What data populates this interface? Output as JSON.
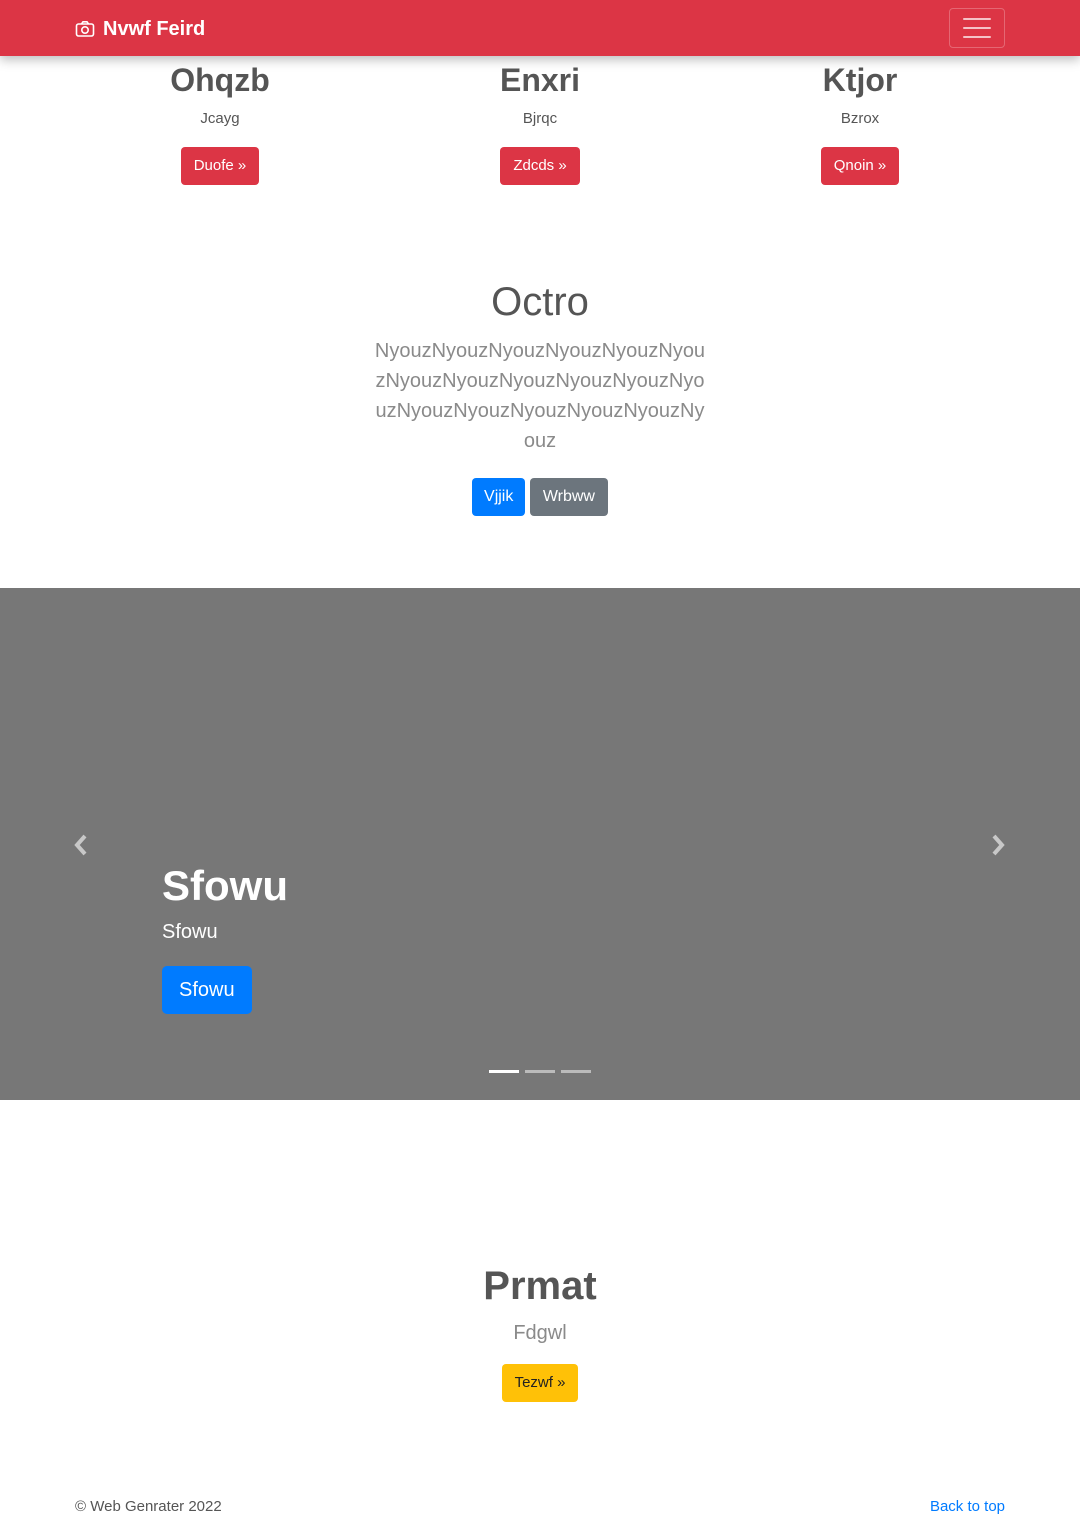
{
  "navbar": {
    "brand": "Nvwf Feird",
    "brand_icon": "camera-icon",
    "toggler_icon": "hamburger-icon",
    "color": "#dc3545"
  },
  "features": [
    {
      "title": "Ohqzb",
      "text": "Jcayg",
      "button": "Duofe »"
    },
    {
      "title": "Enxri",
      "text": "Bjrqc",
      "button": "Zdcds »"
    },
    {
      "title": "Ktjor",
      "text": "Bzrox",
      "button": "Qnoin »"
    }
  ],
  "octro": {
    "title": "Octro",
    "lead": "NyouzNyouzNyouzNyouzNyouzNyouzNyouzNyouzNyouzNyouzNyouzNyouzNyouzNyouzNyouzNyouzNyouzNyouz",
    "primary_button": "Vjjik",
    "secondary_button": "Wrbww"
  },
  "carousel": {
    "title": "Sfowu",
    "text": "Sfowu",
    "button": "Sfowu",
    "prev_icon": "chevron-left-icon",
    "next_icon": "chevron-right-icon",
    "slides": 3,
    "active_slide": 1,
    "background": "#777777"
  },
  "prmat": {
    "title": "Prmat",
    "text": "Fdgwl",
    "button": "Tezwf »"
  },
  "footer": {
    "copyright": "© Web Genrater 2022",
    "back_to_top": "Back to top"
  }
}
